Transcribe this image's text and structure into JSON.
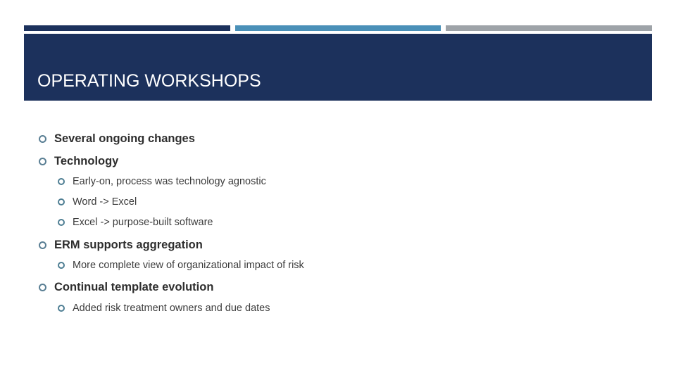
{
  "slide": {
    "title": "OPERATING WORKSHOPS",
    "colors": {
      "title_band": "#1c315c",
      "accent_bar_1": "#1c315c",
      "accent_bar_2": "#4a90b8",
      "accent_bar_3": "#9ea3a8",
      "bullet": "#5a7f94"
    },
    "bullets": [
      {
        "level": 1,
        "text": "Several ongoing changes",
        "icon": "hollow-circle-bullet"
      },
      {
        "level": 1,
        "text": "Technology",
        "icon": "hollow-circle-bullet"
      },
      {
        "level": 2,
        "text": "Early-on, process was technology agnostic",
        "icon": "hollow-circle-bullet"
      },
      {
        "level": 2,
        "text": "Word -> Excel",
        "icon": "hollow-circle-bullet"
      },
      {
        "level": 2,
        "text": "Excel -> purpose-built software",
        "icon": "hollow-circle-bullet"
      },
      {
        "level": 1,
        "text": "ERM supports aggregation",
        "icon": "hollow-circle-bullet"
      },
      {
        "level": 2,
        "text": "More complete view of organizational impact of risk",
        "icon": "hollow-circle-bullet"
      },
      {
        "level": 1,
        "text": "Continual template evolution",
        "icon": "hollow-circle-bullet"
      },
      {
        "level": 2,
        "text": "Added risk treatment owners and due dates",
        "icon": "hollow-circle-bullet"
      }
    ]
  }
}
